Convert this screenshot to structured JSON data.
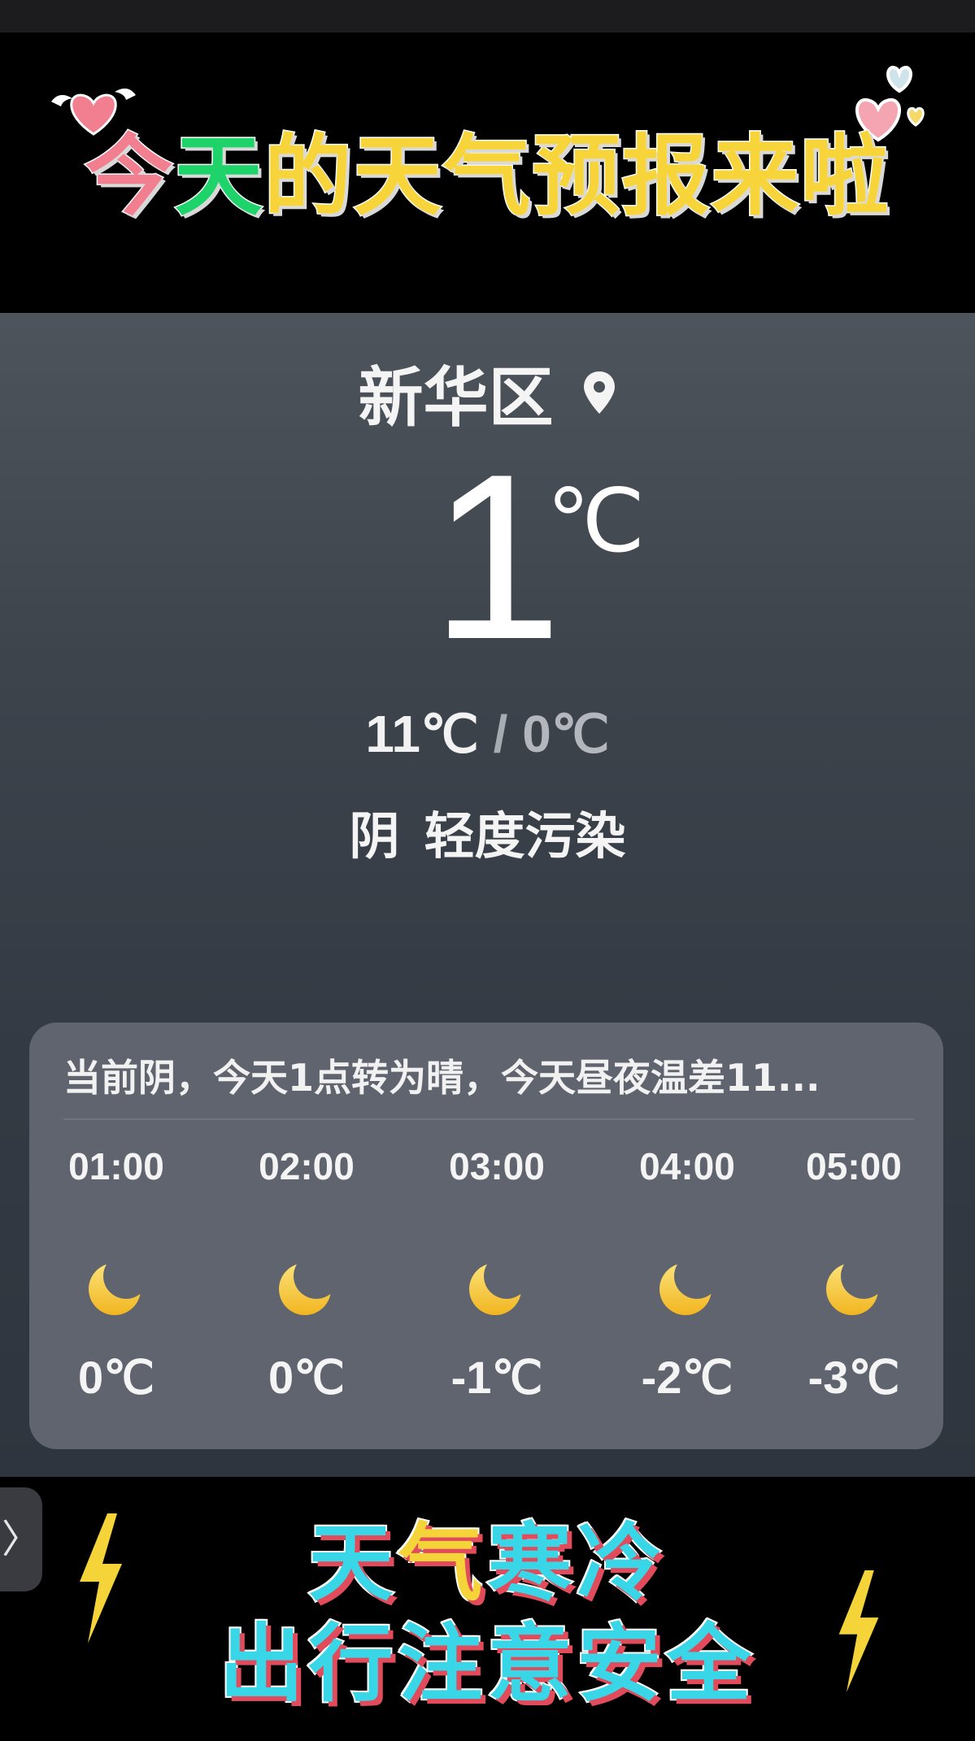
{
  "header": {
    "headline_parts": [
      "今",
      "天",
      "的天气预报来啦"
    ],
    "colors": {
      "pink": "#f27f8f",
      "green": "#1ed46a",
      "yellow": "#f7d43a"
    }
  },
  "weather": {
    "location": "新华区",
    "location_icon": "location-pin-icon",
    "current_temp": "1",
    "temp_unit": "℃",
    "high": "11℃",
    "separator": "/",
    "low": "0℃",
    "condition": "阴",
    "air_quality": "轻度污染"
  },
  "forecast": {
    "summary": "当前阴，今天1点转为晴，今天昼夜温差11...",
    "hours": [
      {
        "time": "01:00",
        "icon": "moon-icon",
        "temp": "0℃"
      },
      {
        "time": "02:00",
        "icon": "moon-icon",
        "temp": "0℃"
      },
      {
        "time": "03:00",
        "icon": "moon-icon",
        "temp": "-1℃"
      },
      {
        "time": "04:00",
        "icon": "moon-icon",
        "temp": "-2℃"
      },
      {
        "time": "05:00",
        "icon": "moon-icon",
        "temp": "-3℃"
      }
    ]
  },
  "footer": {
    "line1_parts": [
      "天",
      "气",
      "寒冷"
    ],
    "line2": "出行注意安全",
    "side_tab_glyph": "〉",
    "colors": {
      "cyan": "#38d6e6",
      "yellow": "#f5d43a",
      "shadow": "#e24b5b"
    }
  }
}
